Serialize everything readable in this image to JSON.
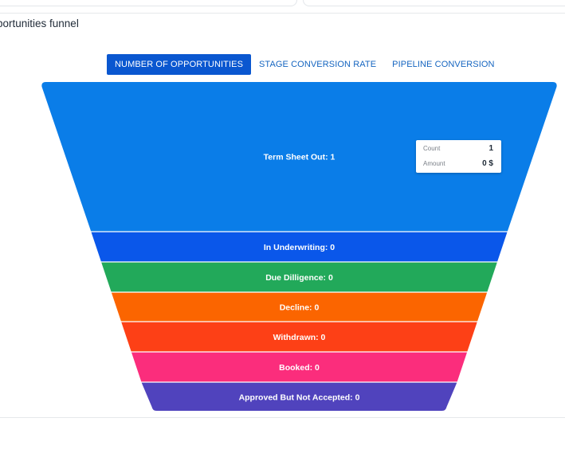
{
  "panel": {
    "title": "portunities funnel"
  },
  "tabs": [
    {
      "label": "NUMBER OF OPPORTUNITIES",
      "active": true
    },
    {
      "label": "STAGE CONVERSION RATE",
      "active": false
    },
    {
      "label": "PIPELINE CONVERSION",
      "active": false
    }
  ],
  "tooltip": {
    "count_label": "Count",
    "count_value": "1",
    "amount_label": "Amount",
    "amount_value": "0 $"
  },
  "chart_data": {
    "type": "funnel",
    "categories": [
      "Term Sheet Out",
      "In Underwriting",
      "Due Dilligence",
      "Decline",
      "Withdrawn",
      "Booked",
      "Approved But Not Accepted"
    ],
    "values": [
      1,
      0,
      0,
      0,
      0,
      0,
      0
    ],
    "labels": [
      "Term Sheet Out: 1",
      "In Underwriting: 0",
      "Due Dilligence: 0",
      "Decline: 0",
      "Withdrawn: 0",
      "Booked: 0",
      "Approved But Not Accepted: 0"
    ],
    "colors": [
      "#0a7de8",
      "#0a57ea",
      "#22a95a",
      "#fb6500",
      "#fd4016",
      "#fb2d7c",
      "#5043bd"
    ]
  }
}
